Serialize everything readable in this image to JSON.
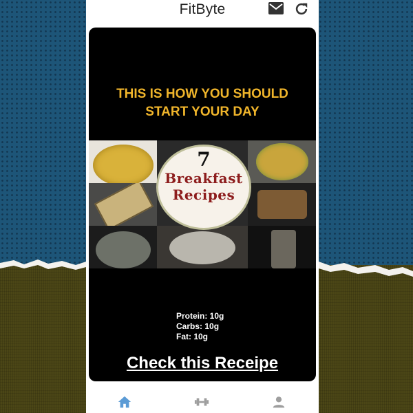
{
  "app": {
    "title": "FitByte"
  },
  "card": {
    "headline_line1": "THIS IS HOW YOU SHOULD",
    "headline_line2": "START YOUR DAY",
    "badge": {
      "number": "7",
      "word1": "Breakfast",
      "word2": "Recipes"
    },
    "macros": [
      {
        "label": "Protein: 10g"
      },
      {
        "label": "Carbs: 10g"
      },
      {
        "label": "Fat: 10g"
      }
    ],
    "cta_label": "Check this Receipe"
  },
  "icons": {
    "top": [
      "mail-icon",
      "refresh-icon"
    ],
    "bottom_nav": [
      "home-icon",
      "dumbbell-icon",
      "profile-icon"
    ]
  },
  "colors": {
    "headline": "#f0b52b",
    "nav_active": "#5b9bd5",
    "nav_inactive": "#9e9e9e"
  }
}
